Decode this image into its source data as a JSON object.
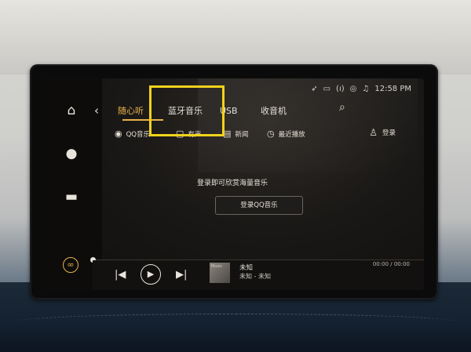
{
  "status": {
    "icons": [
      "navigation-icon",
      "message-icon",
      "signal-icon",
      "wifi-icon",
      "audio-icon"
    ],
    "time": "12:58 PM"
  },
  "sidebar": {
    "items": [
      "home-icon",
      "person-icon",
      "car-icon",
      "loop-icon"
    ]
  },
  "tabs": [
    {
      "label": "随心听",
      "active": true
    },
    {
      "label": "蓝牙音乐",
      "active": false
    },
    {
      "label": "USB",
      "active": false
    },
    {
      "label": "收音机",
      "active": false
    }
  ],
  "subnav": [
    {
      "label": "QQ音乐",
      "icon": "qq-music-icon"
    },
    {
      "label": "有声",
      "icon": "book-icon"
    },
    {
      "label": "新闻",
      "icon": "news-icon"
    },
    {
      "label": "最近播放",
      "icon": "clock-icon"
    }
  ],
  "login": {
    "label": "登录"
  },
  "content": {
    "prompt": "登录即可欣赏海量音乐",
    "button": "登录QQ音乐"
  },
  "player": {
    "cover_text": "Music",
    "track": "未知",
    "artist": "未知 - 未知",
    "time": "00:00 / 00:00",
    "progress": 0
  },
  "colors": {
    "accent": "#e8b24a",
    "highlight": "#f2d21c"
  }
}
